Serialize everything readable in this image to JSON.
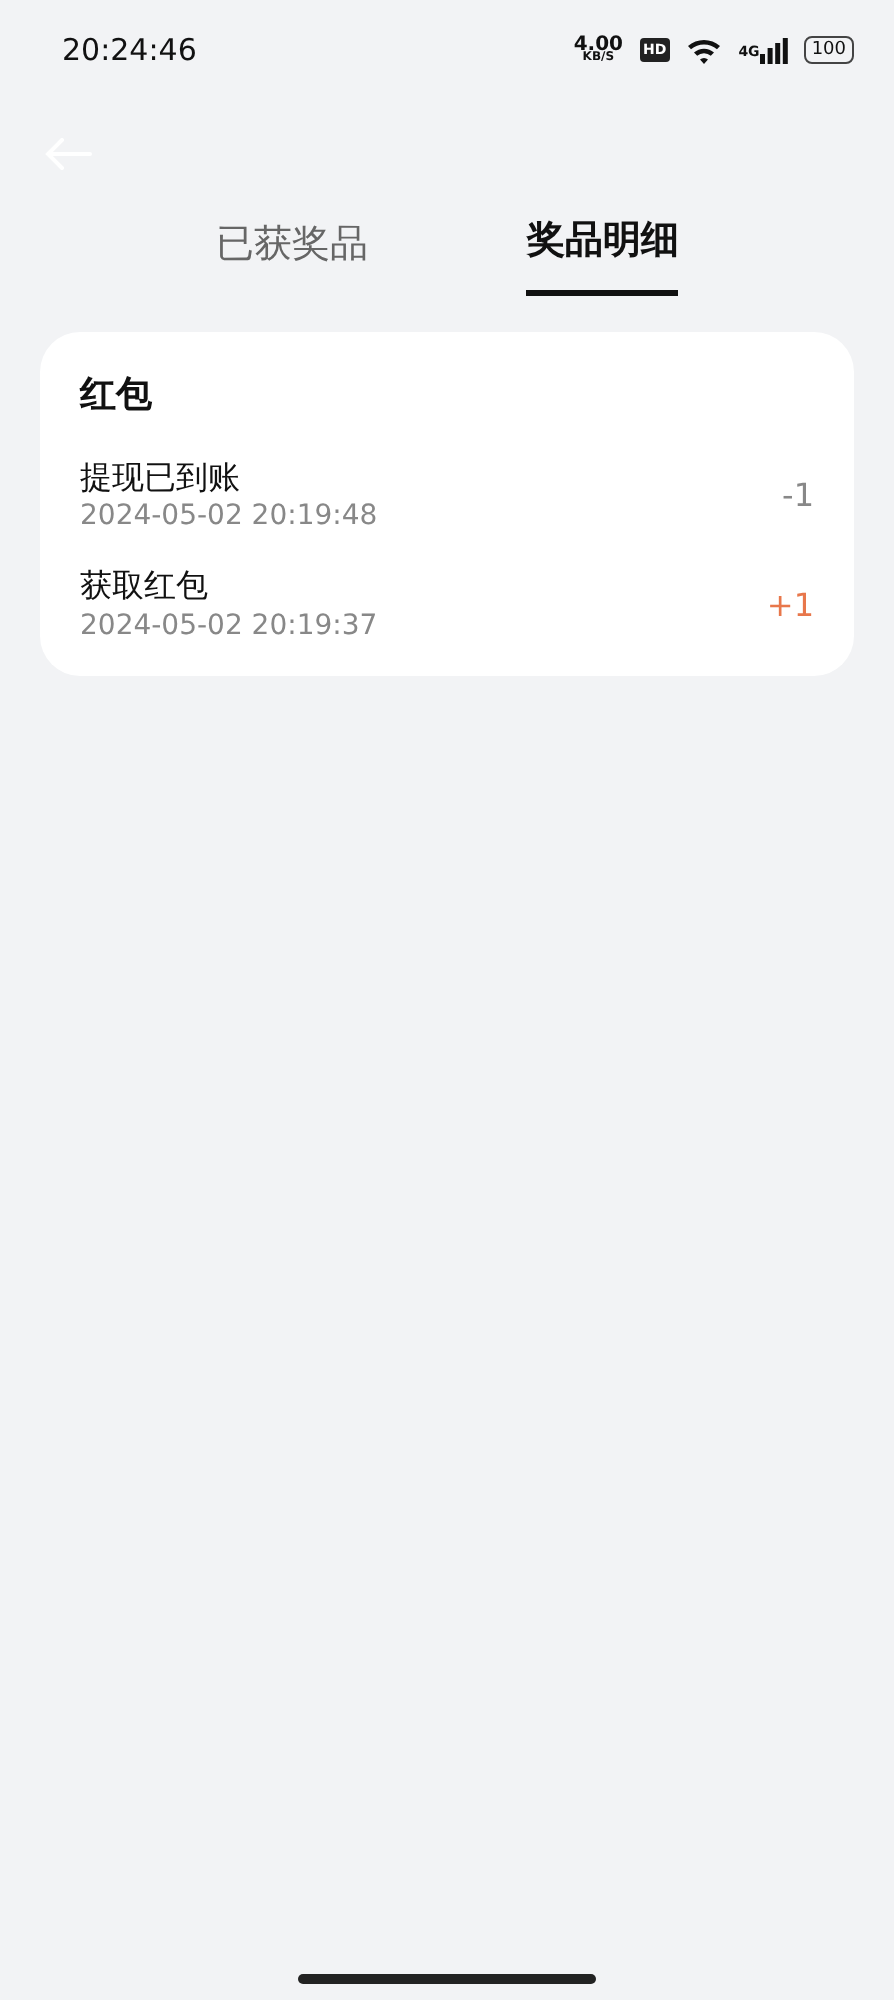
{
  "status_bar": {
    "time": "20:24:46",
    "speed": "4.00",
    "speed_unit": "KB/S",
    "hd": "HD",
    "network": "4G",
    "battery": "100"
  },
  "tabs": [
    {
      "label": "已获奖品",
      "selected": false
    },
    {
      "label": "奖品明细",
      "selected": true
    }
  ],
  "card": {
    "title": "红包",
    "records": [
      {
        "title": "提现已到账",
        "time": "2024-05-02 20:19:48",
        "amount": "-1",
        "kind": "debit"
      },
      {
        "title": "获取红包",
        "time": "2024-05-02 20:19:37",
        "amount": "+1",
        "kind": "credit"
      }
    ]
  }
}
